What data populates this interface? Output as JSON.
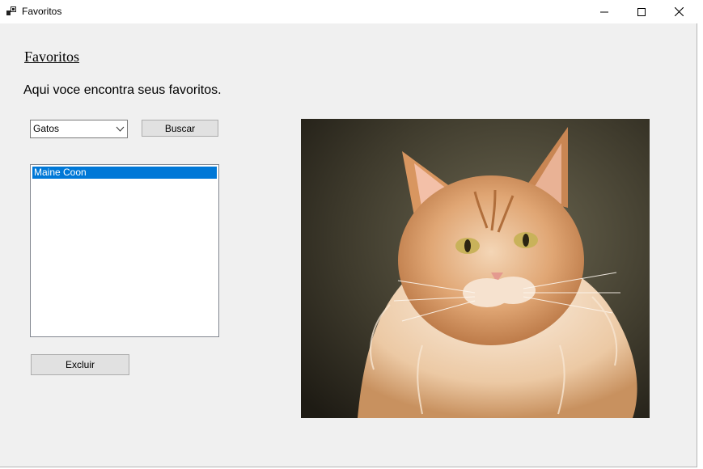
{
  "window": {
    "title": "Favoritos",
    "controls": {
      "minimize": "minimize-icon",
      "maximize": "maximize-icon",
      "close": "close-icon"
    }
  },
  "form": {
    "heading": "Favoritos",
    "subtitle": "Aqui voce encontra seus favoritos.",
    "category_select": {
      "selected": "Gatos"
    },
    "search_button": "Buscar",
    "favorites_list": {
      "items": [
        {
          "label": "Maine Coon",
          "selected": true
        }
      ]
    },
    "delete_button": "Excluir",
    "picture": {
      "subject": "cat-photo"
    }
  },
  "colors": {
    "selection": "#0078d7",
    "form_background": "#f0f0f0",
    "button_face": "#e1e1e1"
  }
}
